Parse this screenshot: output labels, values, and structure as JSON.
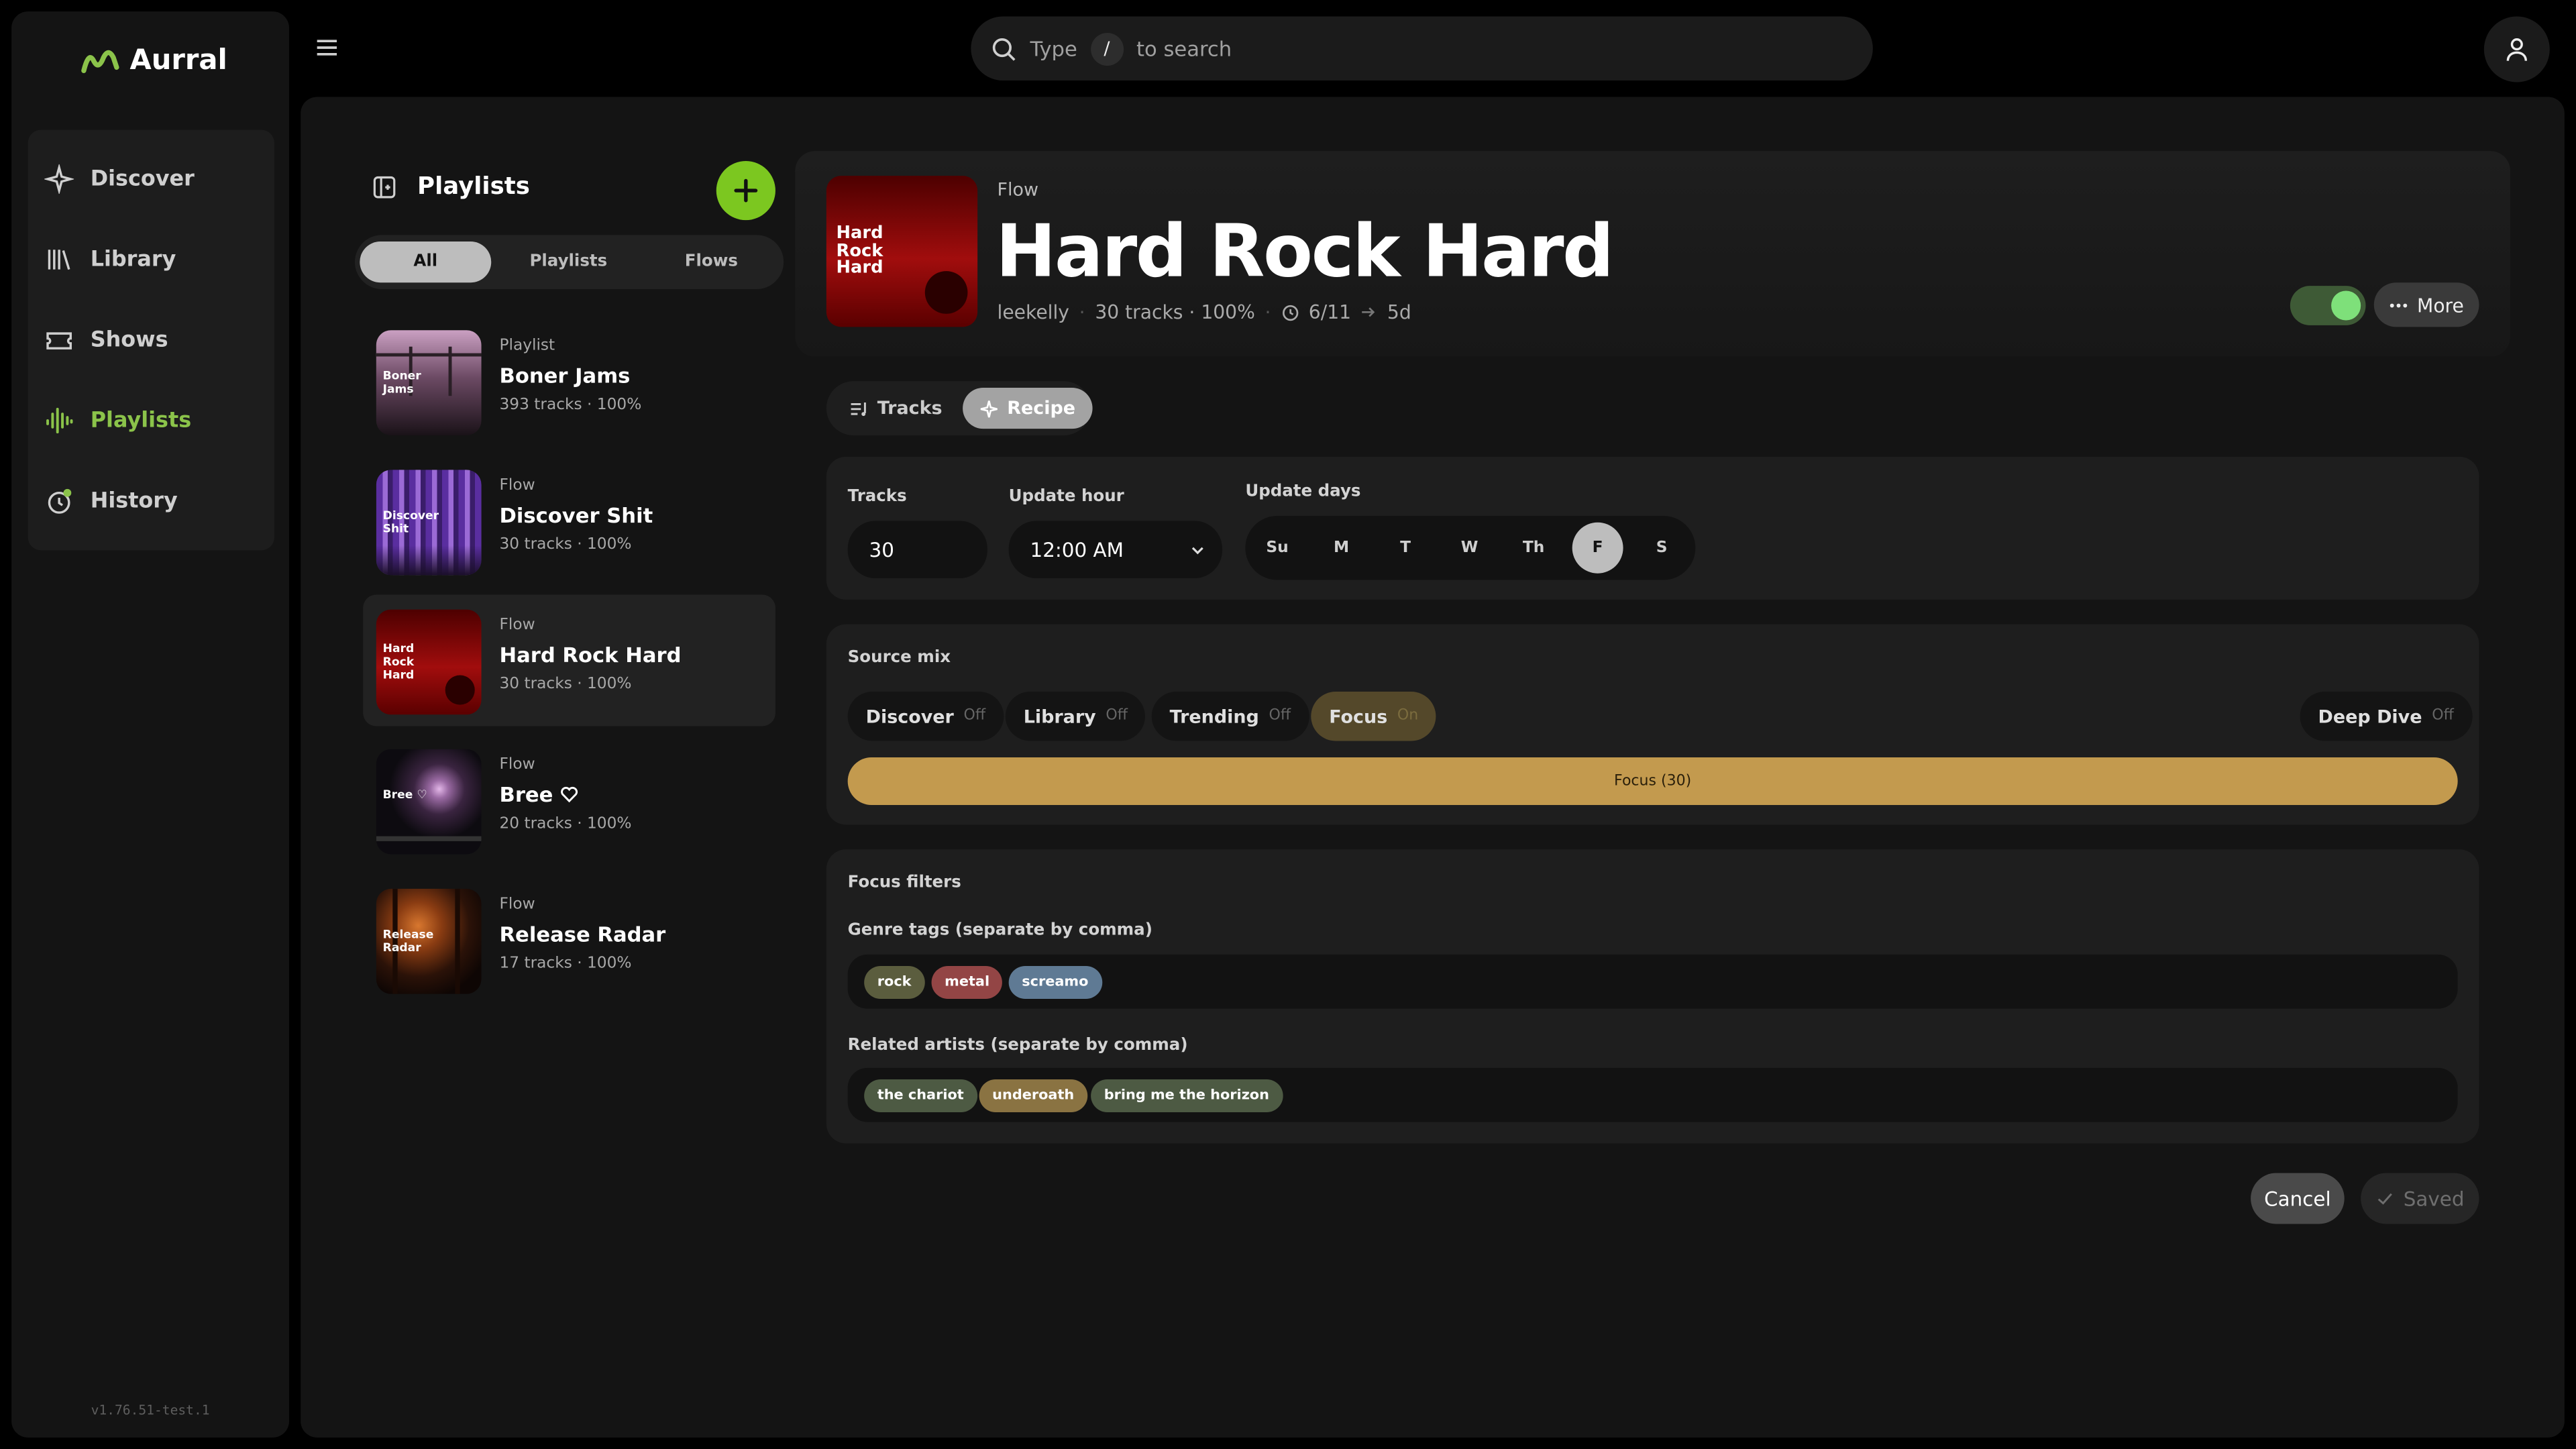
{
  "app": {
    "name": "Aurral",
    "version": "v1.76.51-test.1",
    "accent": "#8bc34a"
  },
  "nav": {
    "items": [
      {
        "label": "Discover",
        "icon": "sparkle-icon"
      },
      {
        "label": "Library",
        "icon": "library-icon"
      },
      {
        "label": "Shows",
        "icon": "ticket-icon"
      },
      {
        "label": "Playlists",
        "icon": "waveform-icon",
        "active": true
      },
      {
        "label": "History",
        "icon": "history-icon"
      }
    ]
  },
  "search": {
    "prefix": "Type",
    "key": "/",
    "suffix": "to search"
  },
  "playlists": {
    "title": "Playlists",
    "filters": [
      "All",
      "Playlists",
      "Flows"
    ],
    "selected_filter": "All",
    "items": [
      {
        "type": "Playlist",
        "name": "Boner Jams",
        "meta": "393 tracks · 100%",
        "thumb_text": "Boner Jams"
      },
      {
        "type": "Flow",
        "name": "Discover Shit",
        "meta": "30 tracks · 100%",
        "thumb_text": "Discover Shit"
      },
      {
        "type": "Flow",
        "name": "Hard Rock Hard",
        "meta": "30 tracks · 100%",
        "thumb_text": "Hard Rock Hard",
        "selected": true
      },
      {
        "type": "Flow",
        "name": "Bree",
        "meta": "20 tracks · 100%",
        "thumb_text": "Bree ♡",
        "heart": true
      },
      {
        "type": "Flow",
        "name": "Release Radar",
        "meta": "17 tracks · 100%",
        "thumb_text": "Release Radar"
      }
    ]
  },
  "detail": {
    "type": "Flow",
    "title": "Hard Rock Hard",
    "cover_text": "Hard Rock Hard",
    "owner": "leekelly",
    "tracks": "30 tracks · 100%",
    "schedule_from": "6/11",
    "schedule_in": "5d",
    "enabled": true,
    "more_label": "More"
  },
  "tabs": {
    "items": [
      "Tracks",
      "Recipe"
    ],
    "selected": "Recipe"
  },
  "recipe": {
    "tracks_label": "Tracks",
    "tracks_value": "30",
    "hour_label": "Update hour",
    "hour_value": "12:00 AM",
    "days_label": "Update days",
    "days": [
      "Su",
      "M",
      "T",
      "W",
      "Th",
      "F",
      "S"
    ],
    "selected_day": "F"
  },
  "source_mix": {
    "label": "Source mix",
    "sources": [
      {
        "name": "Discover",
        "state": "Off"
      },
      {
        "name": "Library",
        "state": "Off"
      },
      {
        "name": "Trending",
        "state": "Off"
      },
      {
        "name": "Focus",
        "state": "On"
      },
      {
        "name": "Deep Dive",
        "state": "Off"
      }
    ],
    "bar_label": "Focus (30)",
    "bar_share": 1.0,
    "bar_color": "#c39a4e"
  },
  "focus_filters": {
    "title": "Focus filters",
    "genre_label": "Genre tags (separate by comma)",
    "genre_tags": [
      {
        "text": "rock",
        "color": "#5b5d3e"
      },
      {
        "text": "metal",
        "color": "#934545"
      },
      {
        "text": "screamo",
        "color": "#5f7a94"
      }
    ],
    "artists_label": "Related artists (separate by comma)",
    "artist_tags": [
      {
        "text": "the chariot",
        "color": "#4d5a43"
      },
      {
        "text": "underoath",
        "color": "#8a7342"
      },
      {
        "text": "bring me the horizon",
        "color": "#4d5a43"
      }
    ]
  },
  "actions": {
    "cancel": "Cancel",
    "saved": "Saved"
  }
}
